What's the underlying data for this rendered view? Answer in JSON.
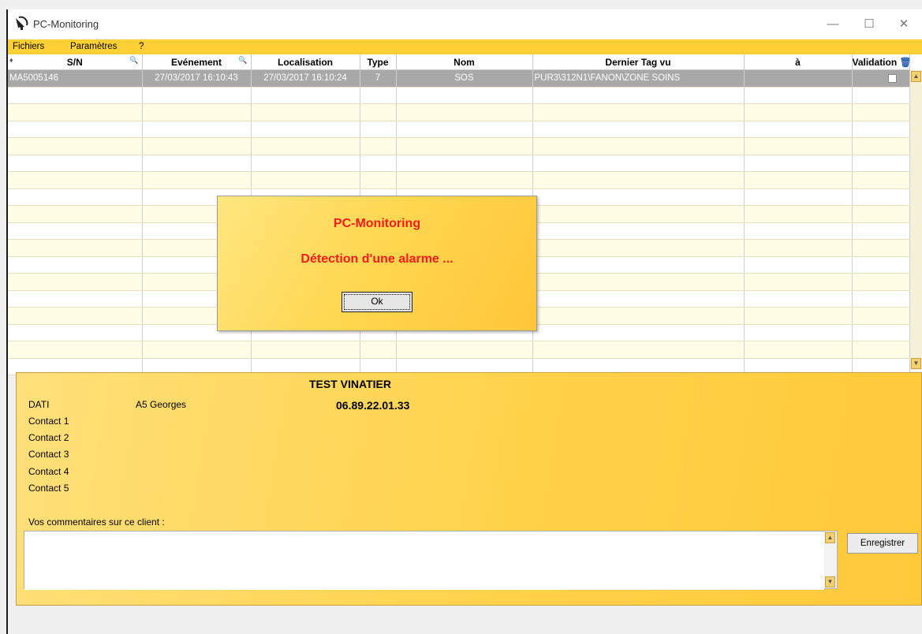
{
  "window": {
    "title": "PC-Monitoring"
  },
  "menu": [
    "Fichiers",
    "Paramètres",
    "?"
  ],
  "grid": {
    "columns": [
      "S/N",
      "Evénement",
      "Localisation",
      "Type",
      "Nom",
      "Dernier Tag vu",
      "à",
      "Validation"
    ],
    "selected_row": {
      "sn": "MA5005146",
      "evenement": "27/03/2017 16:10:43",
      "localisation": "27/03/2017 16:10:24",
      "type": "7",
      "nom": "SOS",
      "dernier_tag": "PUR3\\312N1\\FANON\\ZONE SOINS",
      "a": "",
      "validated": false
    }
  },
  "details": {
    "client_name": "TEST VINATIER",
    "dati_label": "DATI",
    "dati_name": "A5 Georges",
    "dati_phone": "06.89.22.01.33",
    "contacts": [
      "Contact 1",
      "Contact 2",
      "Contact 3",
      "Contact 4",
      "Contact 5"
    ],
    "comments_label": "Vos commentaires sur ce client :",
    "comments_value": "",
    "save_label": "Enregistrer"
  },
  "dialog": {
    "title": "PC-Monitoring",
    "message": "Détection d'une alarme ...",
    "ok_label": "Ok"
  },
  "colors": {
    "menu_bg": "#ffd033",
    "dialog_text": "#ff1a1a",
    "row_alt": "#fffde6",
    "selected_row": "#a8a8a8"
  }
}
